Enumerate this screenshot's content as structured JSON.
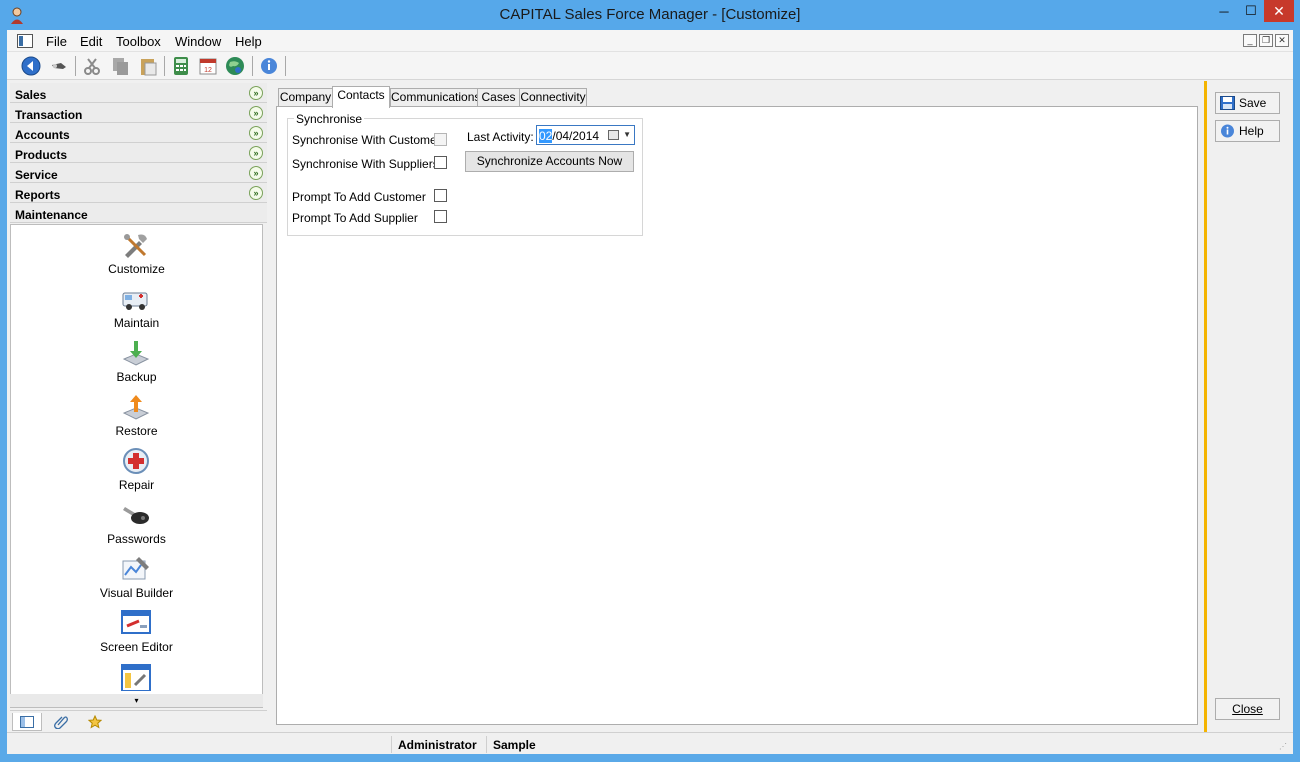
{
  "window": {
    "title": "CAPITAL Sales Force Manager - [Customize]",
    "controls": {
      "minimize": "─",
      "maximize": "☐",
      "close": "✕"
    }
  },
  "menubar": {
    "items": [
      "File",
      "Edit",
      "Toolbox",
      "Window",
      "Help"
    ],
    "mdi_controls": {
      "minimize": "_",
      "restore": "❐",
      "close": "✕"
    }
  },
  "toolbar": {
    "icons": [
      "back-icon",
      "key-icon",
      "cut-icon",
      "copy-icon",
      "paste-icon",
      "calculator-icon",
      "calendar-icon",
      "globe-icon",
      "info-icon"
    ]
  },
  "sidebar": {
    "categories": [
      "Sales",
      "Transaction",
      "Accounts",
      "Products",
      "Service",
      "Reports",
      "Maintenance"
    ],
    "expand_glyph": "»",
    "items": [
      {
        "label": "Customize",
        "icon": "tools-icon"
      },
      {
        "label": "Maintain",
        "icon": "ambulance-icon"
      },
      {
        "label": "Backup",
        "icon": "backup-icon"
      },
      {
        "label": "Restore",
        "icon": "restore-icon"
      },
      {
        "label": "Repair",
        "icon": "first-aid-icon"
      },
      {
        "label": "Passwords",
        "icon": "key-icon"
      },
      {
        "label": "Visual Builder",
        "icon": "visual-builder-icon"
      },
      {
        "label": "Screen Editor",
        "icon": "screen-editor-icon"
      }
    ],
    "scroll_glyph": "▾",
    "bottom_tabs": [
      "folder-list-icon",
      "paperclip-icon",
      "star-icon"
    ]
  },
  "tabs": {
    "items": [
      "Company",
      "Contacts",
      "Communications",
      "Cases",
      "Connectivity"
    ],
    "active": "Contacts"
  },
  "synchronise": {
    "legend": "Synchronise",
    "rows": [
      {
        "label": "Synchronise With Customers",
        "checked": false,
        "enabled": false
      },
      {
        "label": "Synchronise With Suppliers",
        "checked": false,
        "enabled": true
      },
      {
        "label": "Prompt To Add Customer",
        "checked": false,
        "enabled": true
      },
      {
        "label": "Prompt To Add Supplier",
        "checked": false,
        "enabled": true
      }
    ],
    "last_activity_label": "Last Activity:",
    "last_activity_selected": "02",
    "last_activity_rest": "/04/2014",
    "sync_button": "Synchronize Accounts Now"
  },
  "rightpanel": {
    "save": "Save",
    "help": "Help",
    "close": "Close"
  },
  "statusbar": {
    "user": "Administrator",
    "database": "Sample"
  },
  "colors": {
    "titlebar": "#56a8ea",
    "close_button": "#c7392b",
    "accent_divider": "#f4b400",
    "selection": "#3399ff"
  }
}
